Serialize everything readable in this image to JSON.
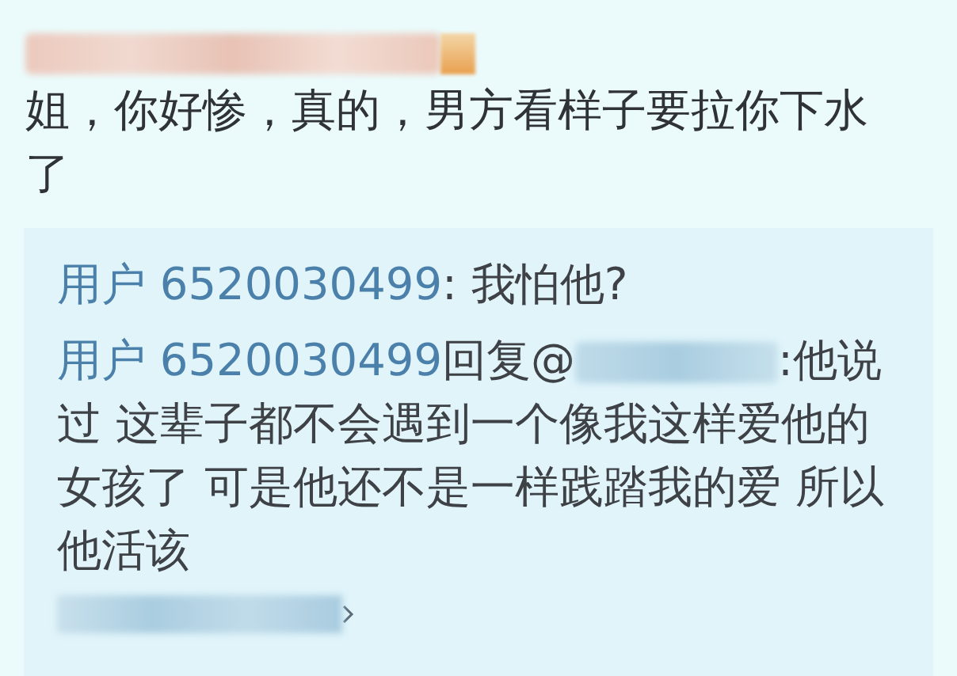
{
  "post": {
    "text": "姐，你好惨，真的，男方看样子要拉你下水了"
  },
  "replies": [
    {
      "kind": "plain",
      "user": "用户 6520030499",
      "text": ": 我怕他?"
    },
    {
      "kind": "reply",
      "user": "用户 6520030499",
      "reply_prefix": "回复@",
      "text": ":他说过 这辈子都不会遇到一个像我这样爱他的女孩了 可是他还不是一样践踏我的爱 所以他活该"
    }
  ]
}
